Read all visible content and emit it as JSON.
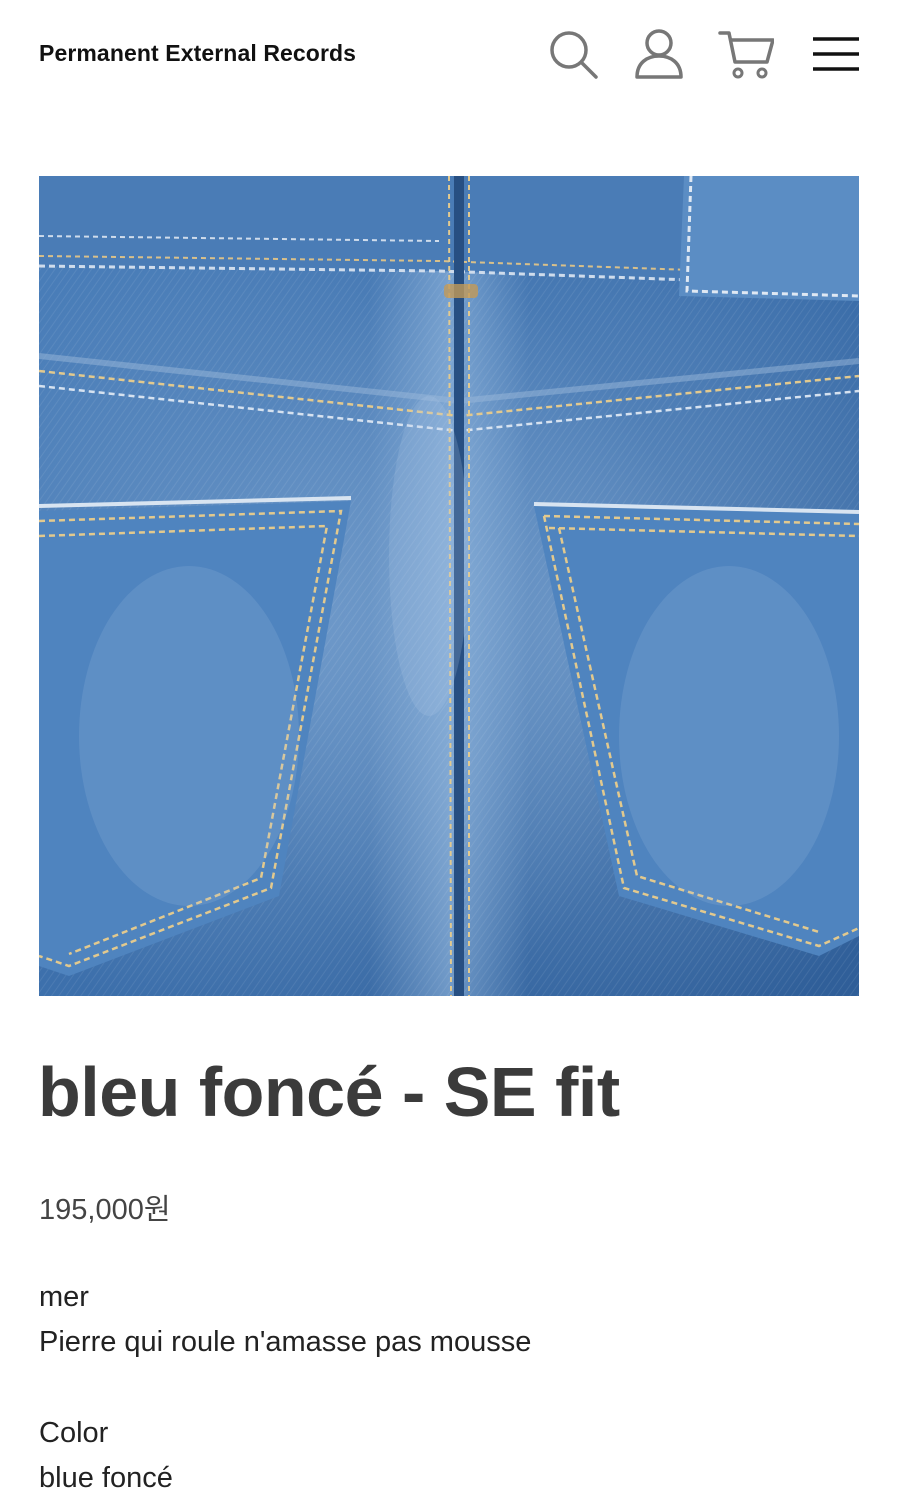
{
  "header": {
    "brand": "Permanent External Records",
    "icons": [
      "search-icon",
      "user-icon",
      "cart-icon",
      "menu-icon"
    ]
  },
  "product": {
    "image_subject": "denim jeans back pockets",
    "title": "bleu foncé - SE fit",
    "price": "195,000원",
    "description": {
      "line1": "mer",
      "line2": "Pierre qui roule n'amasse pas mousse"
    },
    "option": {
      "label": "Color",
      "value": "blue foncé"
    }
  },
  "colors": {
    "text": "#222222",
    "title": "#3b3b3b",
    "denim": "#3a6ea8",
    "background": "#ffffff"
  }
}
